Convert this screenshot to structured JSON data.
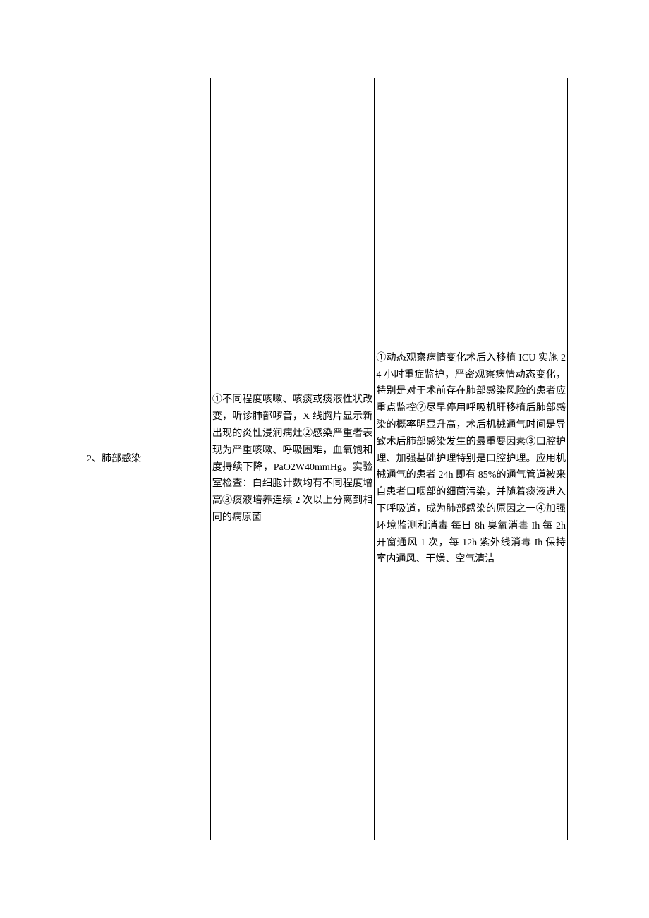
{
  "row": {
    "col1": "2、肺部感染",
    "col2": "①不同程度咳嗽、咳痰或痰液性状改变，听诊肺部啰音，X 线胸片显示新出现的炎性浸润病灶②感染严重者表现为严重咳嗽、呼吸困难，血氧饱和度持续下降，PaO2W40mmHg。实验室检查：白细胞计数均有不同程度增高③痰液培养连续 2 次以上分离到相同的病原菌",
    "col3": "①动态观察病情变化术后入移植 ICU 实施 24 小时重症监护，严密观察病情动态变化，特别是对于术前存在肺部感染风险的患者应重点监控②尽早停用呼吸机肝移植后肺部感染的概率明显升高，术后机械通气时间是导致术后肺部感染发生的最重要因素③口腔护理、加强基础护理特别是口腔护理。应用机械通气的患者 24h 即有 85%的通气管道被来自患者口咽部的细菌污染，并随着痰液进入下呼吸道，成为肺部感染的原因之一④加强环境监测和消毒 每日 8h 臭氧消毒 Ih 每 2h 开窗通风 1 次，每 12h 紫外线消毒 Ih 保持室内通风、干燥、空气清洁"
  }
}
